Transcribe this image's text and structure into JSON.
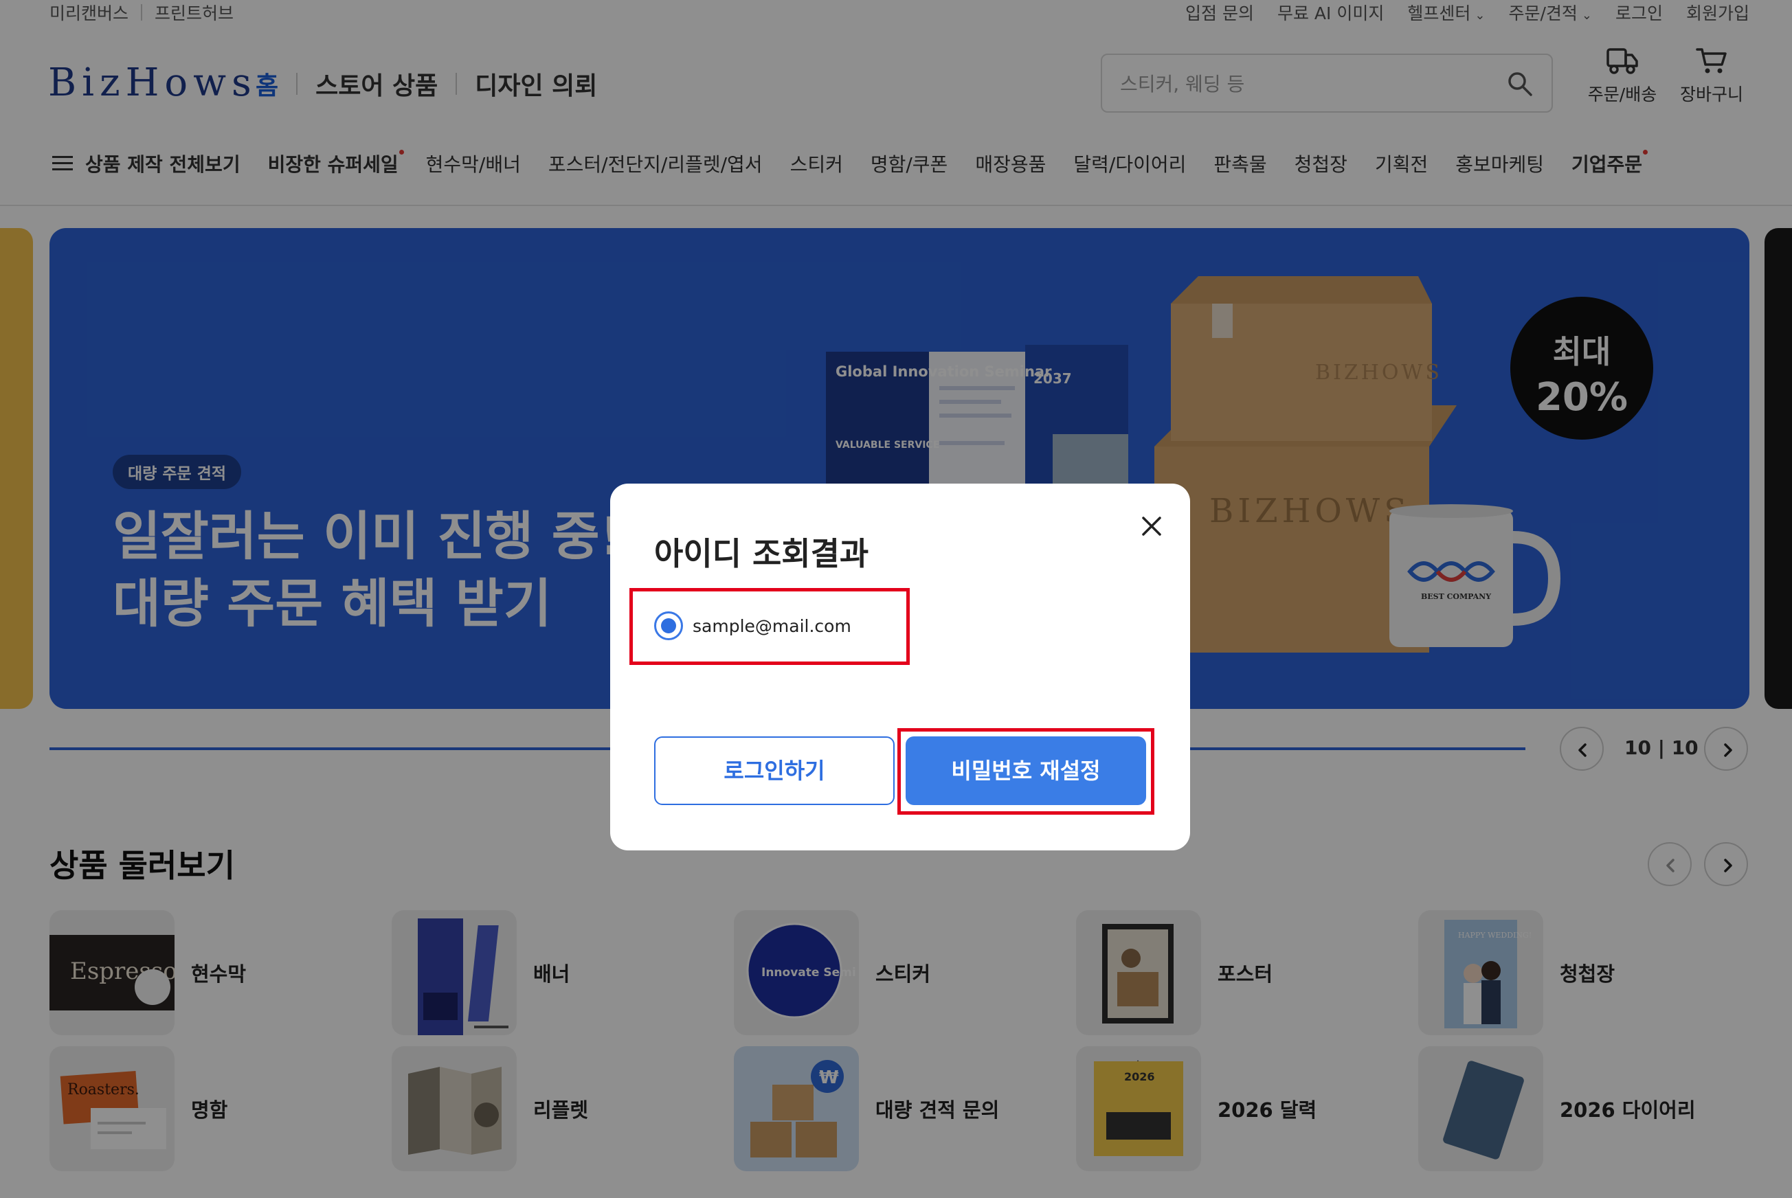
{
  "utility": {
    "left": [
      "미리캔버스",
      "프린트허브"
    ],
    "right": [
      {
        "label": "입점 문의",
        "dropdown": false
      },
      {
        "label": "무료 AI 이미지",
        "dropdown": false
      },
      {
        "label": "헬프센터",
        "dropdown": true
      },
      {
        "label": "주문/견적",
        "dropdown": true
      },
      {
        "label": "로그인",
        "dropdown": false
      },
      {
        "label": "회원가입",
        "dropdown": false
      }
    ]
  },
  "header": {
    "logo": "BizHows",
    "nav": [
      "홈",
      "스토어 상품",
      "디자인 의뢰"
    ],
    "search_placeholder": "스티커, 웨딩 등",
    "order_label": "주문/배송",
    "cart_label": "장바구니"
  },
  "categories": [
    {
      "label": "상품 제작 전체보기",
      "bold": true,
      "dot": false
    },
    {
      "label": "비장한 슈퍼세일",
      "bold": true,
      "dot": true
    },
    {
      "label": "현수막/배너",
      "bold": false,
      "dot": false
    },
    {
      "label": "포스터/전단지/리플렛/엽서",
      "bold": false,
      "dot": false
    },
    {
      "label": "스티커",
      "bold": false,
      "dot": false
    },
    {
      "label": "명함/쿠폰",
      "bold": false,
      "dot": false
    },
    {
      "label": "매장용품",
      "bold": false,
      "dot": false
    },
    {
      "label": "달력/다이어리",
      "bold": false,
      "dot": false
    },
    {
      "label": "판촉물",
      "bold": false,
      "dot": false
    },
    {
      "label": "청첩장",
      "bold": false,
      "dot": false
    },
    {
      "label": "기획전",
      "bold": false,
      "dot": false
    },
    {
      "label": "홍보마케팅",
      "bold": false,
      "dot": false
    },
    {
      "label": "기업주문",
      "bold": true,
      "dot": true
    }
  ],
  "banner": {
    "tag": "대량 주문 견적",
    "headline_line1": "일잘러는 이미 진행 중!",
    "headline_line2": "대량 주문 혜택 받기",
    "badge_line1": "최대",
    "badge_line2": "20%",
    "brochure_title": "Global Innovation Seminar",
    "brochure_year": "2037",
    "brochure_sub": "VALUABLE SERVICE",
    "box_print": "BIZHOWS",
    "mug_text": "BEST COMPANY",
    "accent": "#2d63d8"
  },
  "pager": {
    "current": "10",
    "total": "10"
  },
  "products_section": {
    "title": "상품 둘러보기",
    "items": [
      {
        "label": "현수막",
        "icon": "banner-sign-icon"
      },
      {
        "label": "배너",
        "icon": "standing-banner-icon"
      },
      {
        "label": "스티커",
        "icon": "sticker-icon"
      },
      {
        "label": "포스터",
        "icon": "poster-icon"
      },
      {
        "label": "청첩장",
        "icon": "wedding-card-icon"
      },
      {
        "label": "명함",
        "icon": "business-card-icon"
      },
      {
        "label": "리플렛",
        "icon": "leaflet-icon"
      },
      {
        "label": "대량 견적 문의",
        "icon": "bulk-boxes-icon"
      },
      {
        "label": "2026 달력",
        "icon": "calendar-icon"
      },
      {
        "label": "2026 다이어리",
        "icon": "diary-icon"
      }
    ],
    "thumb_text": {
      "espresso": "Espresso",
      "sticker": "Innovate Semi",
      "roasters": "Roasters.",
      "calendar": "2026",
      "wedding": "HAPPY WEDDING!",
      "won": "₩"
    }
  },
  "modal": {
    "title": "아이디 조회결과",
    "result_email": "sample@mail.com",
    "login_button": "로그인하기",
    "reset_button": "비밀번호 재설정",
    "primary_color": "#3a7de6",
    "highlight_color": "#e3001b"
  }
}
